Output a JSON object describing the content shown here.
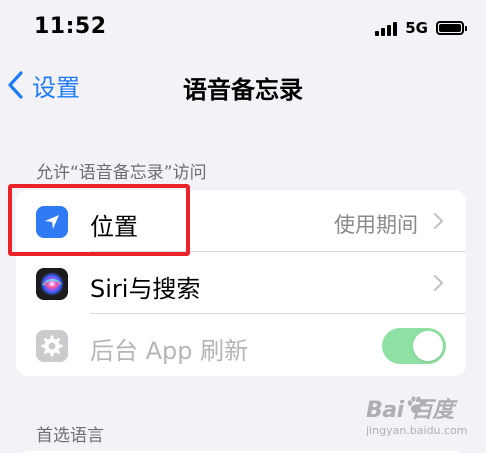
{
  "status_bar": {
    "time": "11:52",
    "network": "5G",
    "battery_icon": "battery-full-icon",
    "signal_icon": "cellular-signal-icon"
  },
  "nav": {
    "back_label": "设置",
    "back_icon": "chevron-left-icon",
    "title": "语音备忘录"
  },
  "access_section": {
    "header": "允许“语音备忘录”访问",
    "rows": [
      {
        "label": "位置",
        "value": "使用期间",
        "icon": "location-arrow-icon",
        "icon_color": "#2f7bf5"
      },
      {
        "label": "Siri与搜索",
        "value": "",
        "icon": "siri-icon",
        "icon_color": "#1c1c1e"
      },
      {
        "label": "后台 App 刷新",
        "icon": "gear-icon",
        "icon_color": "#8e8e93",
        "toggle_on": true,
        "disabled": true
      }
    ]
  },
  "language_section": {
    "header": "首选语言"
  },
  "colors": {
    "accent": "#1f7cf6",
    "toggle_on": "#34c759",
    "highlight": "#e8232a",
    "background": "#f2f2f7"
  },
  "watermark": {
    "logo": "Bai  百度",
    "sub": "jingyan.baidu.com"
  }
}
